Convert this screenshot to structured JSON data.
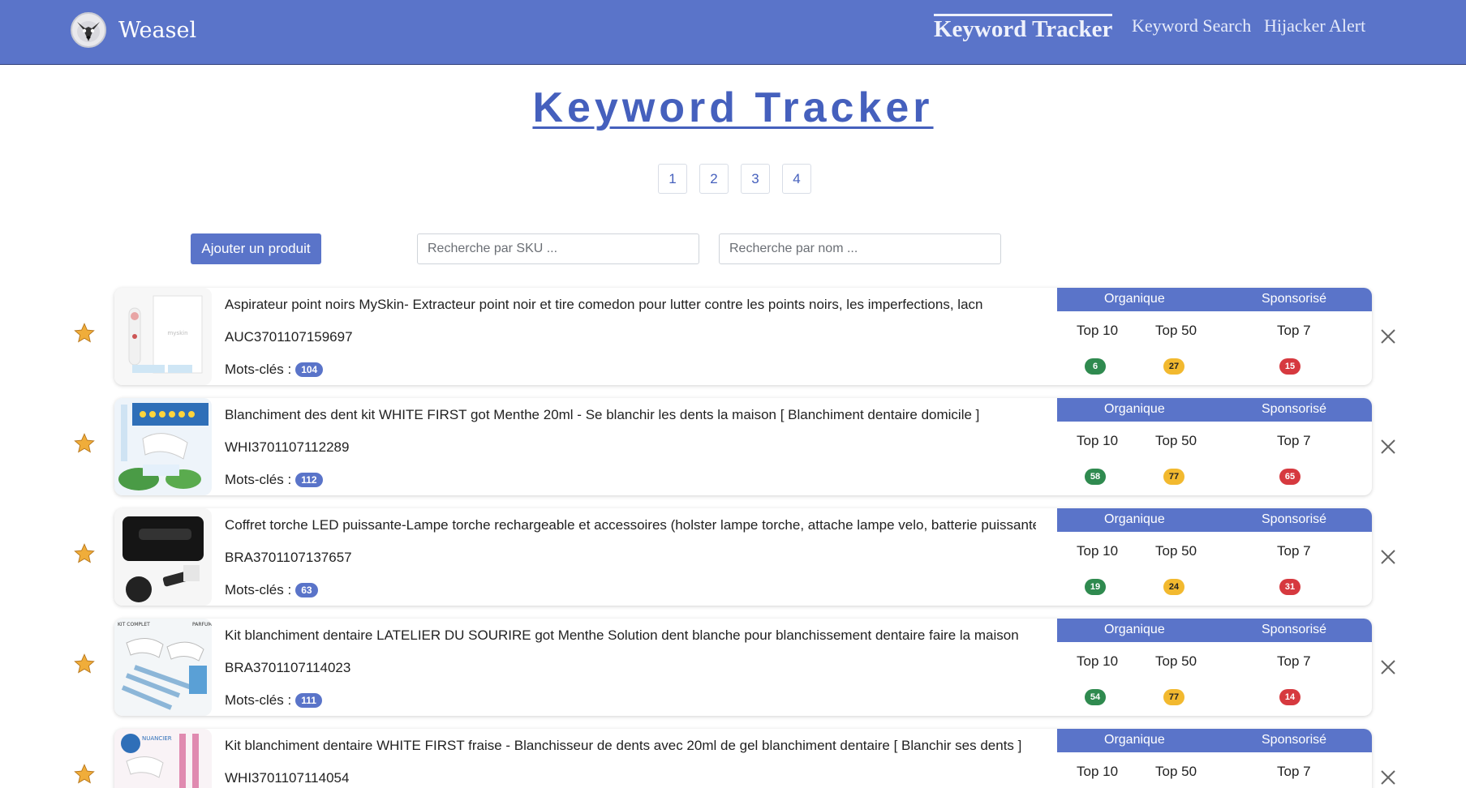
{
  "header": {
    "brand_name": "Weasel",
    "nav": [
      {
        "label": "Keyword Tracker",
        "active": true
      },
      {
        "label": "Keyword Search",
        "active": false
      },
      {
        "label": "Hijacker Alert",
        "active": false
      }
    ]
  },
  "page_title": "Keyword Tracker",
  "pagination": [
    "1",
    "2",
    "3",
    "4"
  ],
  "controls": {
    "add_button": "Ajouter un produit",
    "sku_placeholder": "Recherche par SKU ...",
    "name_placeholder": "Recherche par nom ..."
  },
  "stats_labels": {
    "organic": "Organique",
    "sponsored": "Sponsorisé",
    "top10": "Top 10",
    "top50": "Top 50",
    "top7": "Top 7",
    "keywords": "Mots-clés :"
  },
  "colors": {
    "brand": "#5a74c9",
    "green": "#2f8a4f",
    "yellow": "#f2b92f",
    "red": "#d6393f",
    "star": "#f0ad3a"
  },
  "products": [
    {
      "name": "Aspirateur point noirs MySkin- Extracteur point noir et tire comedon pour lutter contre les points noirs, les imperfections, lacn",
      "sku": "AUC3701107159697",
      "keywords": "104",
      "top10": "6",
      "top50": "27",
      "top7": "15",
      "thumb": "blackhead-vacuum"
    },
    {
      "name": "Blanchiment des dent kit WHITE FIRST got Menthe 20ml - Se blanchir les dents la maison [ Blanchiment dentaire domicile ]",
      "sku": "WHI3701107112289",
      "keywords": "112",
      "top10": "58",
      "top50": "77",
      "top7": "65",
      "thumb": "whitening-kit-mint"
    },
    {
      "name": "Coffret torche LED puissante-Lampe torche rechargeable et accessoires (holster lampe torche, attache lampe velo, batterie puissante)",
      "sku": "BRA3701107137657",
      "keywords": "63",
      "top10": "19",
      "top50": "24",
      "top7": "31",
      "thumb": "led-torch"
    },
    {
      "name": "Kit blanchiment dentaire LATELIER DU SOURIRE got Menthe Solution dent blanche pour blanchissement dentaire faire la maison",
      "sku": "BRA3701107114023",
      "keywords": "111",
      "top10": "54",
      "top50": "77",
      "top7": "14",
      "thumb": "whitening-syringes"
    },
    {
      "name": "Kit blanchiment dentaire WHITE FIRST fraise - Blanchisseur de dents avec 20ml de gel blanchiment dentaire [ Blanchir ses dents ]",
      "sku": "WHI3701107114054",
      "keywords": "",
      "top10": "",
      "top50": "",
      "top7": "",
      "thumb": "whitening-kit-strawberry"
    }
  ]
}
